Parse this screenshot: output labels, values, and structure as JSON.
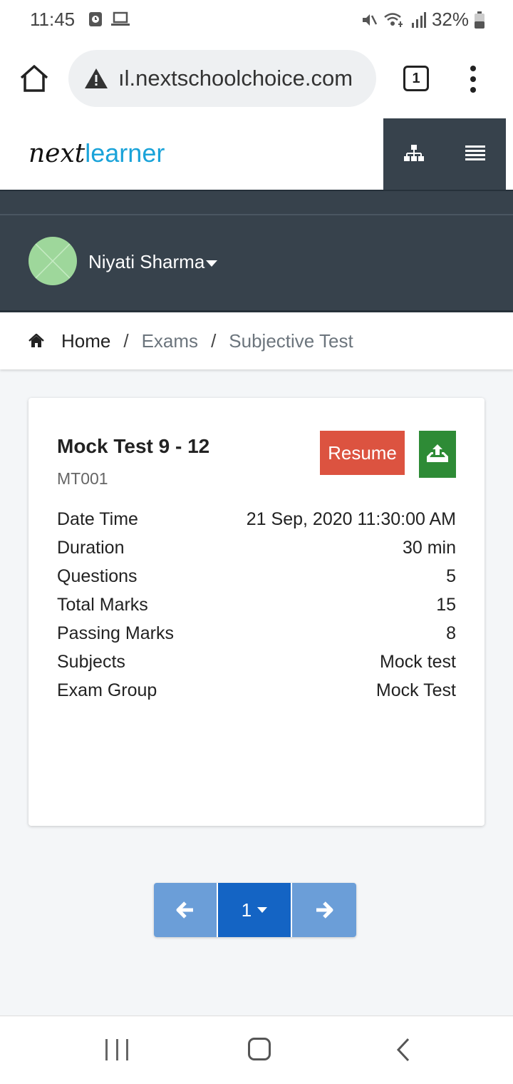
{
  "status_bar": {
    "time": "11:45",
    "battery": "32%",
    "icons": [
      "alarm-icon",
      "laptop-icon",
      "mute-icon",
      "wifi-icon",
      "signal-icon",
      "battery-icon"
    ]
  },
  "browser": {
    "url": "ıl.nextschoolchoice.com",
    "tab_count": "1"
  },
  "header": {
    "logo_part1": "next",
    "logo_part2": "learner"
  },
  "user": {
    "name": "Niyati Sharma"
  },
  "breadcrumb": {
    "home": "Home",
    "separator": "/",
    "item1": "Exams",
    "item2": "Subjective Test"
  },
  "exam": {
    "title": "Mock Test 9 - 12",
    "code": "MT001",
    "resume_label": "Resume",
    "details": [
      {
        "label": "Date Time",
        "value": "21 Sep, 2020 11:30:00 AM"
      },
      {
        "label": "Duration",
        "value": "30 min"
      },
      {
        "label": "Questions",
        "value": "5"
      },
      {
        "label": "Total Marks",
        "value": "15"
      },
      {
        "label": "Passing Marks",
        "value": "8"
      },
      {
        "label": "Subjects",
        "value": "Mock test"
      },
      {
        "label": "Exam Group",
        "value": "Mock Test"
      }
    ]
  },
  "pagination": {
    "current_page": "1"
  },
  "colors": {
    "header_dark": "#37424c",
    "resume": "#dc5340",
    "upload": "#2e8b36",
    "pager_active": "#1464c4",
    "pager": "#6b9ed8",
    "logo_accent": "#1aa3d9"
  }
}
